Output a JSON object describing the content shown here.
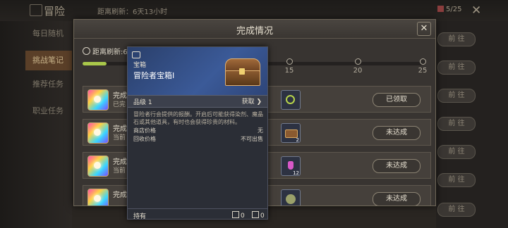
{
  "background": {
    "title": "冒险",
    "refresh": "距离刷新：6天13小时",
    "count": "5/25",
    "nav": [
      "每日随机",
      "挑战笔记",
      "推荐任务",
      "职业任务"
    ],
    "goto_label": "前 往"
  },
  "modal": {
    "title": "完成情况",
    "refresh": "距离刷新:6天",
    "progress": {
      "fraction": 0.07,
      "milestones": [
        "15",
        "20",
        "25"
      ]
    },
    "rows": [
      {
        "name": "完成",
        "sub": "已完",
        "reward": "check",
        "reward_count": "",
        "status": "已领取"
      },
      {
        "name": "完成",
        "sub": "当前",
        "reward": "chest",
        "reward_count": "2",
        "status": "未达成"
      },
      {
        "name": "完成",
        "sub": "当前",
        "reward": "potion",
        "reward_count": "12",
        "status": "未达成"
      },
      {
        "name": "完成",
        "sub": "",
        "reward": "orb",
        "reward_count": "",
        "status": "未达成"
      }
    ]
  },
  "tooltip": {
    "category": "宝箱",
    "item_name": "冒险者宝箱I",
    "grade": "品级 1",
    "obtain": "获取 ❯",
    "description": "冒险者行会提供的报酬。开启后可能获得染剂、魔晶石或其他道具，有时也会获得珍贵的材料。",
    "shop_price_label": "商店价格",
    "shop_price_value": "无",
    "sell_price_label": "回收价格",
    "sell_price_value": "不可出售",
    "owned_label": "持有",
    "owned_count_1": "0",
    "owned_count_2": "0"
  },
  "colors": {
    "progress": "#a9c84a",
    "modal_bg": "#383431",
    "tooltip_head": "#3b5a98"
  }
}
